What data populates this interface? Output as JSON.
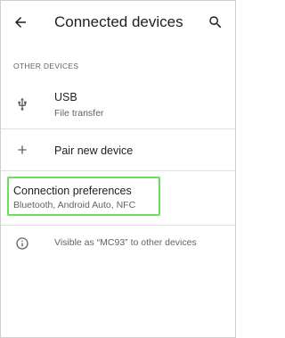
{
  "app_bar": {
    "title": "Connected devices",
    "back_icon": "arrow-left-icon",
    "search_icon": "search-icon"
  },
  "section": {
    "header": "OTHER DEVICES"
  },
  "usb": {
    "icon": "usb-icon",
    "title": "USB",
    "subtitle": "File transfer"
  },
  "pair": {
    "icon": "plus-icon",
    "title": "Pair new device"
  },
  "preferences": {
    "title": "Connection preferences",
    "subtitle": "Bluetooth, Android Auto, NFC",
    "highlight_color": "#6be05a"
  },
  "footer": {
    "icon": "info-icon",
    "text": "Visible as “MC93” to other devices"
  }
}
